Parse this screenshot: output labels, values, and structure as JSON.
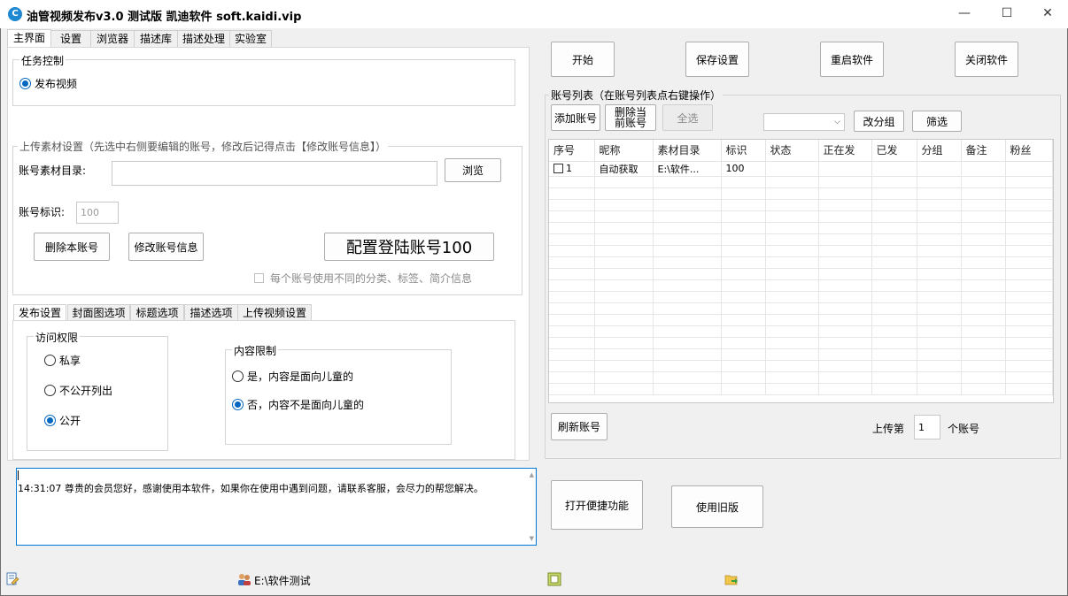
{
  "window": {
    "title": "油管视频发布v3.0  测试版  凯迪软件 soft.kaidi.vip",
    "minimize": "—",
    "maximize": "☐",
    "close": "✕"
  },
  "main_tabs": [
    "主界面",
    "设置",
    "浏览器",
    "描述库",
    "描述处理",
    "实验室"
  ],
  "task_control": {
    "title": "任务控制",
    "option": "发布视频"
  },
  "upload": {
    "title": "上传素材设置（先选中右侧要编辑的账号，修改后记得点击【修改账号信息】）",
    "dir_label": "账号素材目录:",
    "dir_value": "",
    "browse": "浏览",
    "id_label": "账号标识:",
    "id_placeholder": "100",
    "delete_btn": "删除本账号",
    "modify_btn": "修改账号信息",
    "config_btn": "配置登陆账号100",
    "per_account_check": "每个账号使用不同的分类、标签、简介信息"
  },
  "sub_tabs": [
    "发布设置",
    "封面图选项",
    "标题选项",
    "描述选项",
    "上传视频设置"
  ],
  "access": {
    "title": "访问权限",
    "options": [
      "私享",
      "不公开列出",
      "公开"
    ],
    "selected": 2
  },
  "content_limit": {
    "title": "内容限制",
    "options": [
      "是，内容是面向儿童的",
      "否，内容不是面向儿童的"
    ],
    "selected": 1
  },
  "log": {
    "text": "14:31:07 尊贵的会员您好，感谢使用本软件，如果你在使用中遇到问题，请联系客服，会尽力的帮您解决。"
  },
  "top_buttons": [
    "开始",
    "保存设置",
    "重启软件",
    "关闭软件"
  ],
  "accounts": {
    "title": "账号列表（在账号列表点右键操作）",
    "add": "添加账号",
    "delete_current": "删除当前账号",
    "select_all": "全选",
    "group_dropdown": "",
    "change_group": "改分组",
    "filter": "筛选",
    "columns": [
      "序号",
      "昵称",
      "素材目录",
      "标识",
      "状态",
      "正在发",
      "已发",
      "分组",
      "备注",
      "粉丝"
    ],
    "rows": [
      [
        "1",
        "自动获取",
        "E:\\软件...",
        "100",
        "",
        "",
        "",
        "",
        "",
        ""
      ]
    ],
    "refresh": "刷新账号",
    "upload_prefix": "上传第",
    "upload_value": "1",
    "upload_suffix": "个账号"
  },
  "bottom_buttons": [
    "打开便捷功能",
    "使用旧版"
  ],
  "statusbar": {
    "path": "E:\\软件测试"
  }
}
